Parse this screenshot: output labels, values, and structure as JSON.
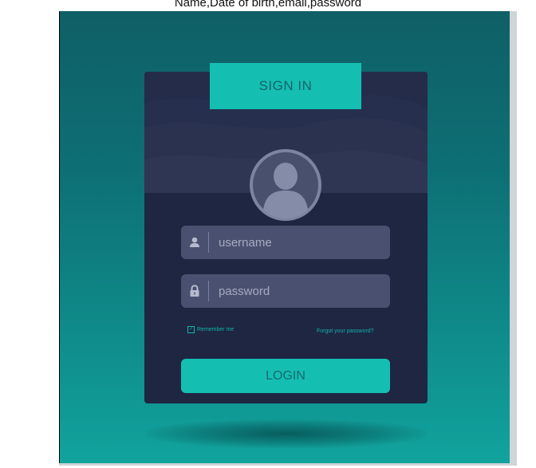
{
  "caption": "Name,Date of birth,email,password",
  "card": {
    "title": "SIGN IN",
    "username_placeholder": "username",
    "password_placeholder": "password",
    "remember_label": "Remember me",
    "remember_checked": true,
    "forgot_label": "Forgot your password?",
    "login_label": "LOGIN"
  },
  "icons": {
    "avatar": "user-avatar-icon",
    "username": "user-icon",
    "password": "lock-icon",
    "checkbox": "checkbox-icon"
  },
  "colors": {
    "background_top": "#0f5f66",
    "background_bottom": "#11a39d",
    "card": "#1e2642",
    "accent": "#14bfb2",
    "field": "#4a5170"
  }
}
